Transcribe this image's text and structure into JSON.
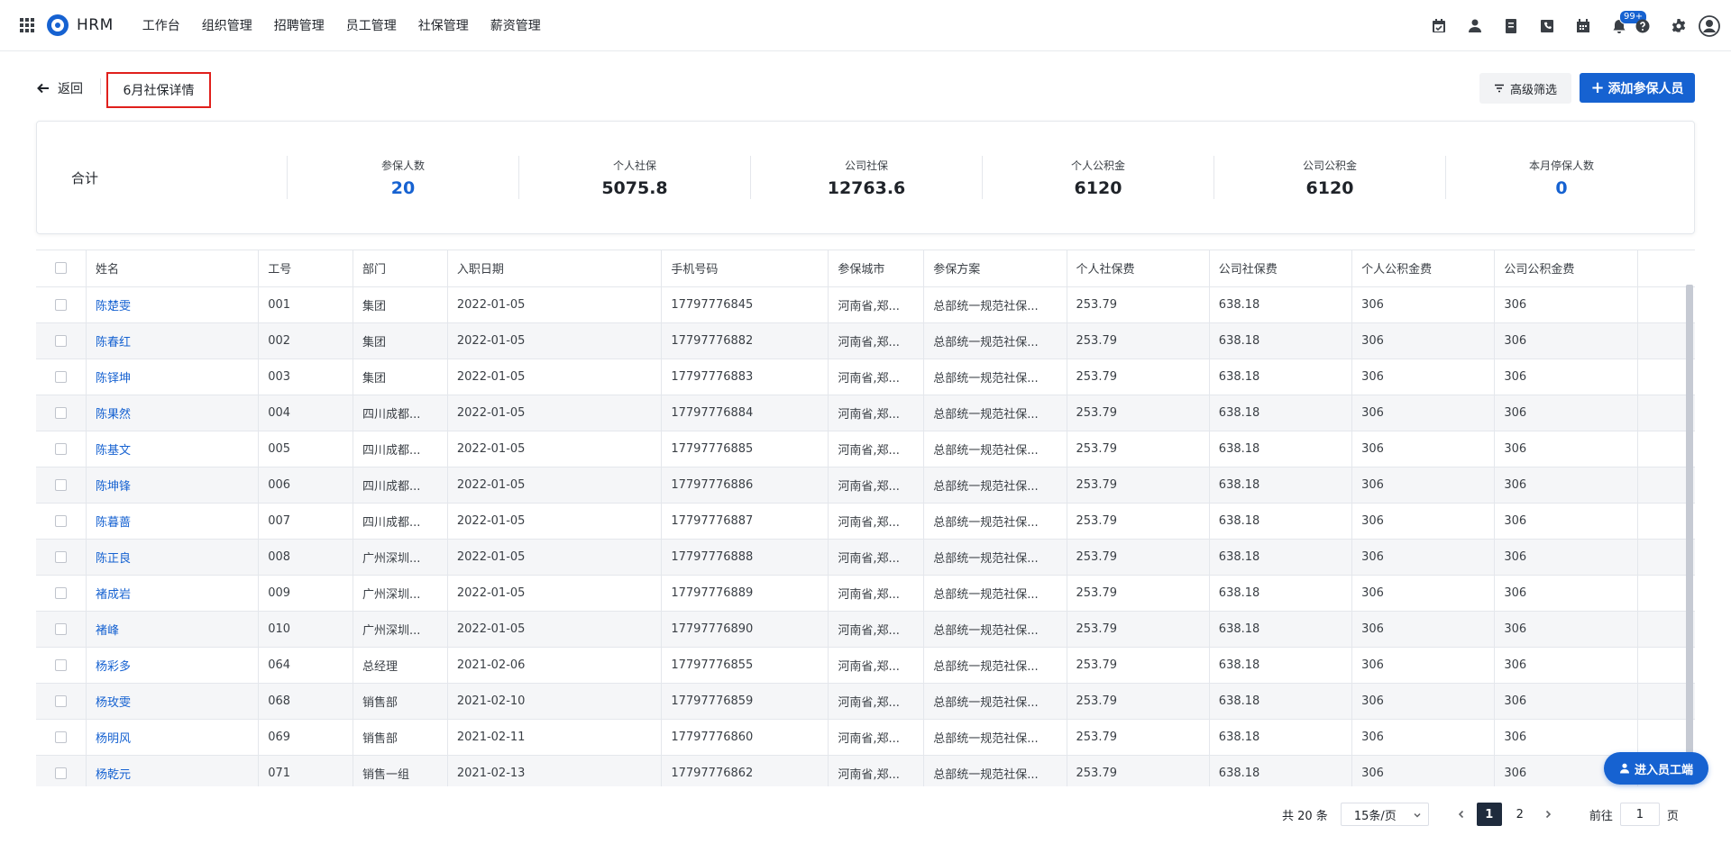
{
  "brand": "HRM",
  "nav": [
    "工作台",
    "组织管理",
    "招聘管理",
    "员工管理",
    "社保管理",
    "薪资管理"
  ],
  "toolbar": {
    "icons": [
      "calendar-check-icon",
      "user-icon",
      "document-icon",
      "phone-icon",
      "schedule-icon",
      "bell-icon",
      "help-icon",
      "gear-icon",
      "avatar-icon"
    ],
    "notification_badge": "99+"
  },
  "header": {
    "back_label": "返回",
    "title": "6月社保详情",
    "filter_label": "高级筛选",
    "add_label": "添加参保人员"
  },
  "summary": {
    "label": "合计",
    "stats": [
      {
        "label": "参保人数",
        "value": "20",
        "highlight": true
      },
      {
        "label": "个人社保",
        "value": "5075.8",
        "highlight": false
      },
      {
        "label": "公司社保",
        "value": "12763.6",
        "highlight": false
      },
      {
        "label": "个人公积金",
        "value": "6120",
        "highlight": false
      },
      {
        "label": "公司公积金",
        "value": "6120",
        "highlight": false
      },
      {
        "label": "本月停保人数",
        "value": "0",
        "highlight": true
      }
    ]
  },
  "table": {
    "columns": [
      "姓名",
      "工号",
      "部门",
      "入职日期",
      "手机号码",
      "参保城市",
      "参保方案",
      "个人社保费",
      "公司社保费",
      "个人公积金费",
      "公司公积金费"
    ],
    "rows": [
      [
        "陈楚雯",
        "001",
        "集团",
        "2022-01-05",
        "17797776845",
        "河南省,郑...",
        "总部统一规范社保...",
        "253.79",
        "638.18",
        "306",
        "306"
      ],
      [
        "陈春红",
        "002",
        "集团",
        "2022-01-05",
        "17797776882",
        "河南省,郑...",
        "总部统一规范社保...",
        "253.79",
        "638.18",
        "306",
        "306"
      ],
      [
        "陈铎坤",
        "003",
        "集团",
        "2022-01-05",
        "17797776883",
        "河南省,郑...",
        "总部统一规范社保...",
        "253.79",
        "638.18",
        "306",
        "306"
      ],
      [
        "陈果然",
        "004",
        "四川成都...",
        "2022-01-05",
        "17797776884",
        "河南省,郑...",
        "总部统一规范社保...",
        "253.79",
        "638.18",
        "306",
        "306"
      ],
      [
        "陈基文",
        "005",
        "四川成都...",
        "2022-01-05",
        "17797776885",
        "河南省,郑...",
        "总部统一规范社保...",
        "253.79",
        "638.18",
        "306",
        "306"
      ],
      [
        "陈坤锋",
        "006",
        "四川成都...",
        "2022-01-05",
        "17797776886",
        "河南省,郑...",
        "总部统一规范社保...",
        "253.79",
        "638.18",
        "306",
        "306"
      ],
      [
        "陈暮蔷",
        "007",
        "四川成都...",
        "2022-01-05",
        "17797776887",
        "河南省,郑...",
        "总部统一规范社保...",
        "253.79",
        "638.18",
        "306",
        "306"
      ],
      [
        "陈正良",
        "008",
        "广州深圳...",
        "2022-01-05",
        "17797776888",
        "河南省,郑...",
        "总部统一规范社保...",
        "253.79",
        "638.18",
        "306",
        "306"
      ],
      [
        "褚成岩",
        "009",
        "广州深圳...",
        "2022-01-05",
        "17797776889",
        "河南省,郑...",
        "总部统一规范社保...",
        "253.79",
        "638.18",
        "306",
        "306"
      ],
      [
        "褚峰",
        "010",
        "广州深圳...",
        "2022-01-05",
        "17797776890",
        "河南省,郑...",
        "总部统一规范社保...",
        "253.79",
        "638.18",
        "306",
        "306"
      ],
      [
        "杨彩多",
        "064",
        "总经理",
        "2021-02-06",
        "17797776855",
        "河南省,郑...",
        "总部统一规范社保...",
        "253.79",
        "638.18",
        "306",
        "306"
      ],
      [
        "杨玫雯",
        "068",
        "销售部",
        "2021-02-10",
        "17797776859",
        "河南省,郑...",
        "总部统一规范社保...",
        "253.79",
        "638.18",
        "306",
        "306"
      ],
      [
        "杨明风",
        "069",
        "销售部",
        "2021-02-11",
        "17797776860",
        "河南省,郑...",
        "总部统一规范社保...",
        "253.79",
        "638.18",
        "306",
        "306"
      ],
      [
        "杨乾元",
        "071",
        "销售一组",
        "2021-02-13",
        "17797776862",
        "河南省,郑...",
        "总部统一规范社保...",
        "253.79",
        "638.18",
        "306",
        "306"
      ]
    ]
  },
  "pagination": {
    "total_label": "共 20 条",
    "page_size": "15条/页",
    "pages": [
      "1",
      "2"
    ],
    "current_page": "1",
    "goto_label": "前往",
    "goto_value": "1",
    "page_suffix": "页"
  },
  "float_button": "进入员工端",
  "colors": {
    "accent": "#1662d1",
    "highlight_border": "#e0201c"
  }
}
